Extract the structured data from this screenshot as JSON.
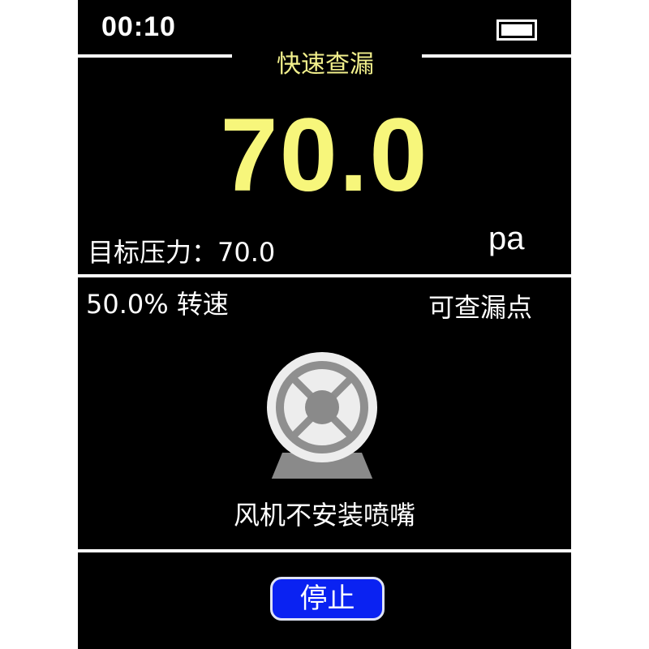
{
  "status_bar": {
    "time": "00:10",
    "battery_icon": "battery-full-icon"
  },
  "header": {
    "mode_title": "快速查漏"
  },
  "readout": {
    "pressure_value": "70.0",
    "unit": "pa",
    "target_pressure_label": "目标压力：70.0"
  },
  "info_row": {
    "fan_speed": "50.0% 转速",
    "leak_status": "可查漏点"
  },
  "fan_panel": {
    "icon": "fan-icon",
    "caption": "风机不安装喷嘴"
  },
  "footer": {
    "stop_label": "停止"
  },
  "colors": {
    "screen_background": "#000000",
    "pressure_text": "#f7f67b",
    "mode_title_text": "#f2f08c",
    "stop_button": "#0a22f2"
  }
}
